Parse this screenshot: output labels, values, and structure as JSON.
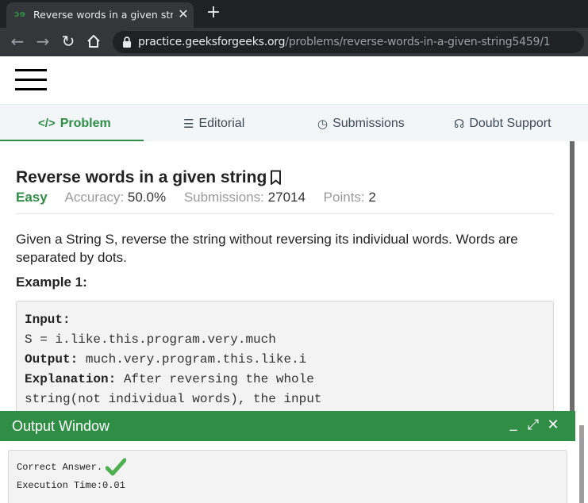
{
  "browser": {
    "tab_title": "Reverse words in a given string | ",
    "tab_favicon": "ɔɘ",
    "url_host": "practice.geeksforgeeks.org",
    "url_path": "/problems/reverse-words-in-a-given-string5459/1",
    "icons": [
      "back-icon",
      "forward-icon",
      "reload-icon",
      "home-icon",
      "lock-icon"
    ]
  },
  "nav_tabs": [
    {
      "label": "Problem",
      "icon": "</>",
      "active": true
    },
    {
      "label": "Editorial",
      "icon": "☰",
      "active": false
    },
    {
      "label": "Submissions",
      "icon": "◷",
      "active": false
    },
    {
      "label": "Doubt Support",
      "icon": "☊",
      "active": false
    }
  ],
  "problem": {
    "title": "Reverse words in a given string",
    "difficulty": "Easy",
    "accuracy_label": "Accuracy:",
    "accuracy": "50.0%",
    "submissions_label": "Submissions:",
    "submissions": "27014",
    "points_label": "Points:",
    "points": "2",
    "description": "Given a String S, reverse the string without reversing its individual words. Words are separated by dots.",
    "example_title": "Example 1:",
    "example": {
      "input_label": "Input:",
      "input_value": "S = i.like.this.program.very.much",
      "output_label": "Output:",
      "output_value": " much.very.program.this.like.i",
      "explanation_label": "Explanation:",
      "explanation_line1": " After reversing the whole",
      "explanation_line2": "string(not individual words), the input"
    }
  },
  "output_window": {
    "title": "Output Window",
    "minimize": "_",
    "expand": "⤢",
    "close": "✕",
    "result": "Correct Answer.",
    "execution": "Execution Time:0.01"
  },
  "colors": {
    "accent": "#2f8d46",
    "chrome_dark": "#202124",
    "chrome_toolbar": "#35363a"
  }
}
